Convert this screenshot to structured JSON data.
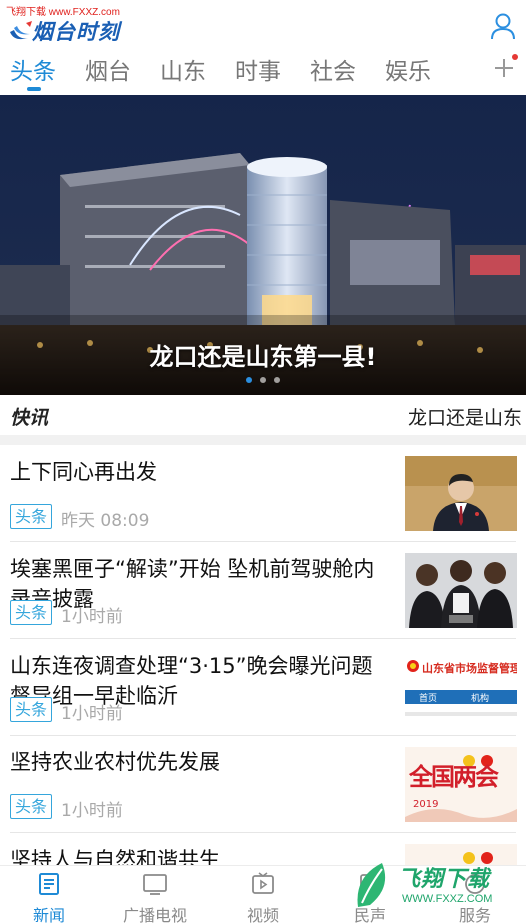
{
  "watermark_top": "飞翔下载 www.FXXZ.com",
  "app": {
    "logo_text": "烟台时刻"
  },
  "tabs": [
    {
      "label": "头条",
      "active": true
    },
    {
      "label": "烟台"
    },
    {
      "label": "山东"
    },
    {
      "label": "时事"
    },
    {
      "label": "社会"
    },
    {
      "label": "娱乐"
    }
  ],
  "banner": {
    "caption": "龙口还是山东第一县!",
    "dots": 3,
    "active_dot": 1
  },
  "kuaixun": {
    "label": "快讯",
    "text": "龙口还是山东"
  },
  "news": [
    {
      "title": "上下同心再出发",
      "tag": "头条",
      "time": "昨天 08:09",
      "thumb": "portrait"
    },
    {
      "title": "埃塞黑匣子“解读”开始 坠机前驾驶舱内录音披露",
      "tag": "头条",
      "time": "1小时前",
      "thumb": "people"
    },
    {
      "title": "山东连夜调查处理“3·15”晚会曝光问题 督导组一早赴临沂",
      "tag": "头条",
      "time": "1小时前",
      "thumb": "website"
    },
    {
      "title": "坚持农业农村优先发展",
      "tag": "头条",
      "time": "1小时前",
      "thumb": "lianghui"
    },
    {
      "title": "坚持人与自然和谐共生",
      "tag": "",
      "time": "",
      "thumb": "lianghui2"
    }
  ],
  "thumb_text": {
    "website_header": "山东省市场监督管理",
    "website_nav": [
      "首页",
      "机构"
    ],
    "lianghui_year": "2019",
    "lianghui_title": "全国两会"
  },
  "bottom_nav": [
    {
      "label": "新闻",
      "icon": "news-icon",
      "active": true
    },
    {
      "label": "广播电视",
      "icon": "tv-icon"
    },
    {
      "label": "视频",
      "icon": "video-icon"
    },
    {
      "label": "民声",
      "icon": "voice-icon"
    },
    {
      "label": "服务",
      "icon": "service-icon"
    }
  ],
  "watermark_bottom": {
    "text": "飞翔下载",
    "url": "WWW.FXXZ.COM"
  },
  "colors": {
    "accent": "#1e8ad6",
    "tag": "#35a6dc",
    "logo": "#1a5fb4"
  }
}
